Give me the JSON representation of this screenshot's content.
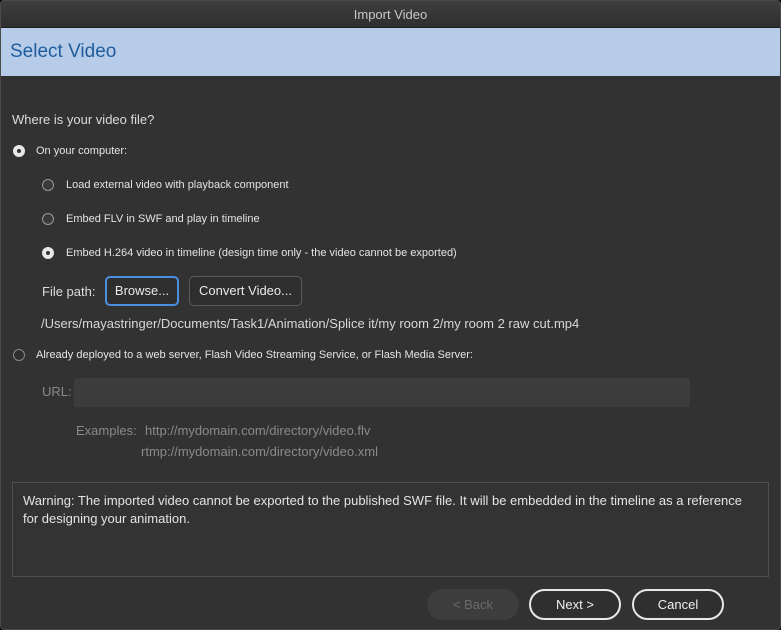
{
  "window": {
    "title": "Import Video"
  },
  "header": {
    "title": "Select Video"
  },
  "question": "Where is your video file?",
  "options": {
    "computer": "On your computer:",
    "external": "Load external video with playback component",
    "embed_flv": "Embed FLV in SWF and play in timeline",
    "embed_h264": "Embed H.264 video in timeline (design time only - the video cannot be exported)",
    "deployed": "Already deployed to a web server, Flash Video Streaming Service, or Flash Media Server:"
  },
  "file": {
    "label": "File path:",
    "browse": "Browse...",
    "convert": "Convert Video...",
    "path": "/Users/mayastringer/Documents/Task1/Animation/Splice it/my room 2/my room 2 raw cut.mp4"
  },
  "url": {
    "label": "URL:",
    "value": ""
  },
  "examples": {
    "label": "Examples:",
    "line1": "http://mydomain.com/directory/video.flv",
    "line2": "rtmp://mydomain.com/directory/video.xml"
  },
  "warning": "Warning: The imported video cannot be exported to the published SWF file. It will be embedded in the timeline as a reference for designing your animation.",
  "buttons": {
    "back": "< Back",
    "next": "Next >",
    "cancel": "Cancel"
  },
  "colors": {
    "header_bg": "#b7cce8",
    "header_text": "#1f5c9e",
    "focus": "#4a8fe0"
  }
}
